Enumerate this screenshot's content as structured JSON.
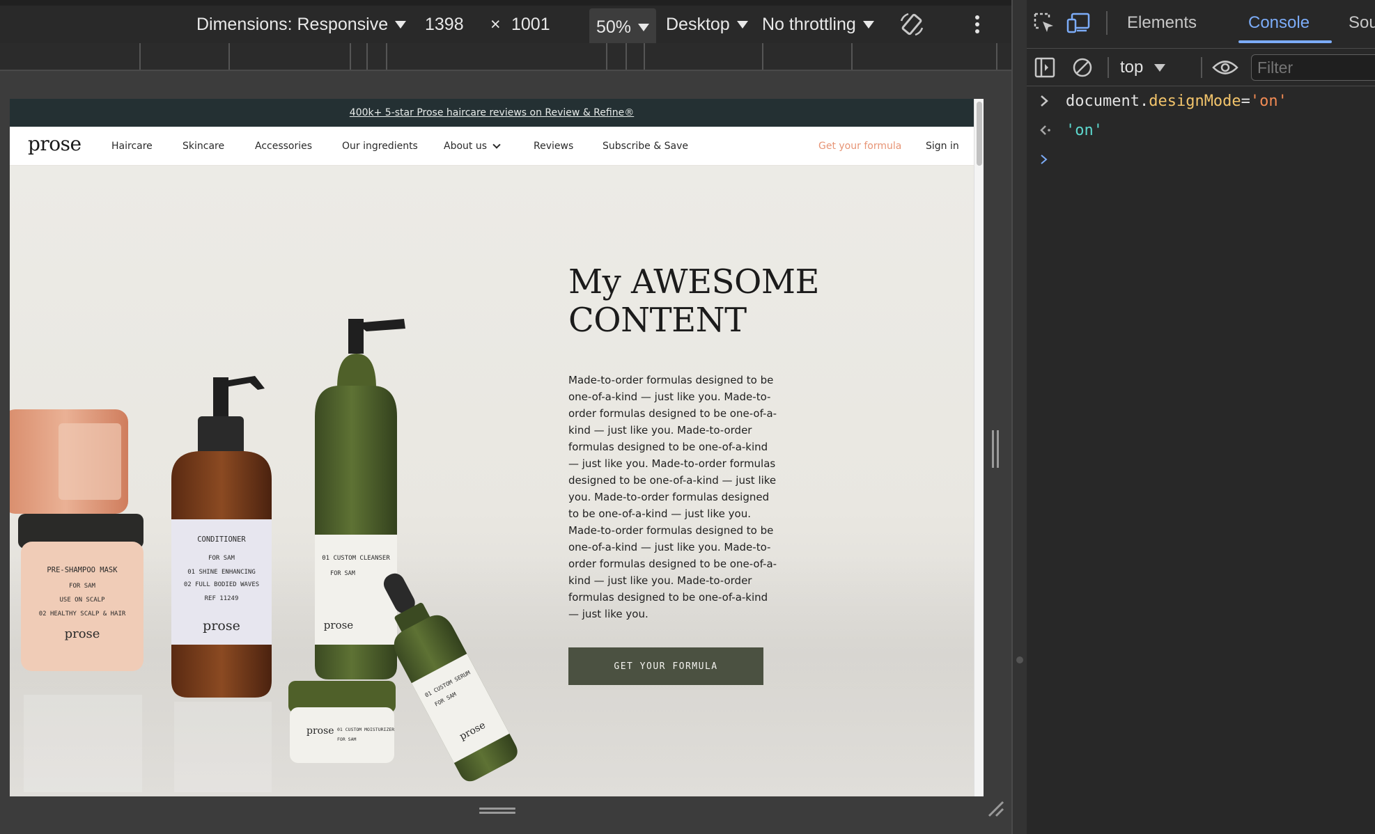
{
  "device_toolbar": {
    "dimensions_label": "Dimensions: Responsive",
    "width": "1398",
    "times": "×",
    "height": "1001",
    "zoom": "50%",
    "device_type": "Desktop",
    "throttling": "No throttling"
  },
  "site": {
    "announcement": "400k+ 5-star Prose haircare reviews on Review & Refine®",
    "logo": "prose",
    "nav": {
      "haircare": "Haircare",
      "skincare": "Skincare",
      "accessories": "Accessories",
      "ingredients": "Our ingredients",
      "about": "About us",
      "reviews": "Reviews",
      "subscribe": "Subscribe & Save",
      "get_formula": "Get your formula",
      "sign_in": "Sign in"
    },
    "hero": {
      "title": "My AWESOME CONTENT",
      "body": "Made-to-order formulas designed to be one-of-a-kind — just like you. Made-to-order formulas designed to be one-of-a-kind — just like you. Made-to-order formulas designed to be one-of-a-kind — just like you. Made-to-order formulas designed to be one-of-a-kind — just like you. Made-to-order formulas designed to be one-of-a-kind — just like you. Made-to-order formulas designed to be one-of-a-kind — just like you. Made-to-order formulas designed to be one-of-a-kind — just like you. Made-to-order formulas designed to be one-of-a-kind — just like you.",
      "cta": "GET YOUR FORMULA",
      "products": {
        "mask_name": "PRE-SHAMPOO MASK",
        "mask_for": "FOR SAM",
        "mask_use": "USE ON SCALP",
        "mask_benefit": "02 HEALTHY SCALP & HAIR",
        "conditioner_name": "CONDITIONER",
        "conditioner_for": "FOR SAM",
        "conditioner_b1": "01 SHINE ENHANCING",
        "conditioner_b2": "02 FULL BODIED WAVES",
        "conditioner_ref": "REF 11249",
        "cleanser_name": "01 CUSTOM CLEANSER",
        "cleanser_for": "FOR SAM",
        "moisturizer_name": "01 CUSTOM MOISTURIZER",
        "moisturizer_for": "FOR SAM",
        "serum_name": "01 CUSTOM SERUM",
        "serum_for": "FOR SAM",
        "brand": "prose"
      }
    }
  },
  "devtools": {
    "tabs": {
      "elements": "Elements",
      "console": "Console",
      "sources": "Sourc"
    },
    "context": "top",
    "filter_placeholder": "Filter",
    "console": {
      "input_obj": "document.",
      "input_prop": "designMode",
      "input_eq": "=",
      "input_val": "'on'",
      "result": "'on'"
    }
  },
  "colors": {
    "announcement_bg": "#243033",
    "cta_bg": "#4b5141",
    "accent_link": "#e79475",
    "devtools_active_tab": "#7cacf8"
  }
}
